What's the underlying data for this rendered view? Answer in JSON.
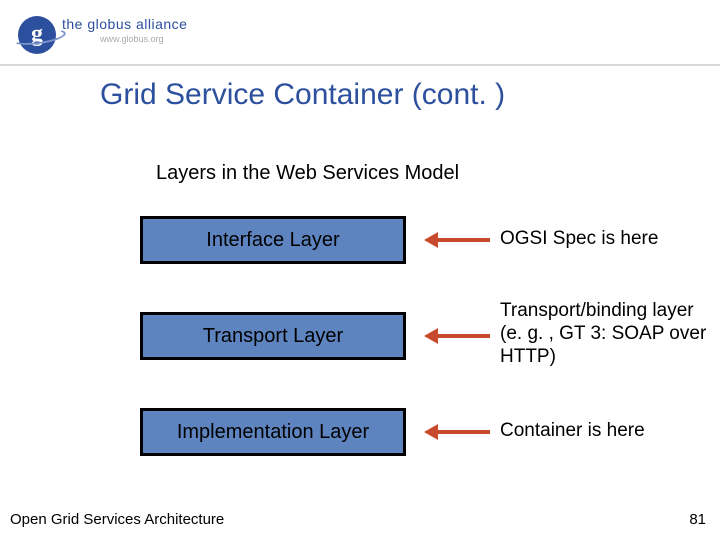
{
  "logo": {
    "brand": "the globus alliance",
    "url": "www.globus.org",
    "glyph": "g"
  },
  "headline": "Grid Service Container (cont. )",
  "subtitle": "Layers in the Web Services Model",
  "layers": [
    {
      "name": "Interface Layer",
      "annotation": "OGSI Spec is here"
    },
    {
      "name": "Transport Layer",
      "annotation": "Transport/binding layer (e. g. , GT 3: SOAP over HTTP)"
    },
    {
      "name": "Implementation Layer",
      "annotation": "Container is here"
    }
  ],
  "footer": {
    "left": "Open Grid Services Architecture",
    "page": "81"
  }
}
